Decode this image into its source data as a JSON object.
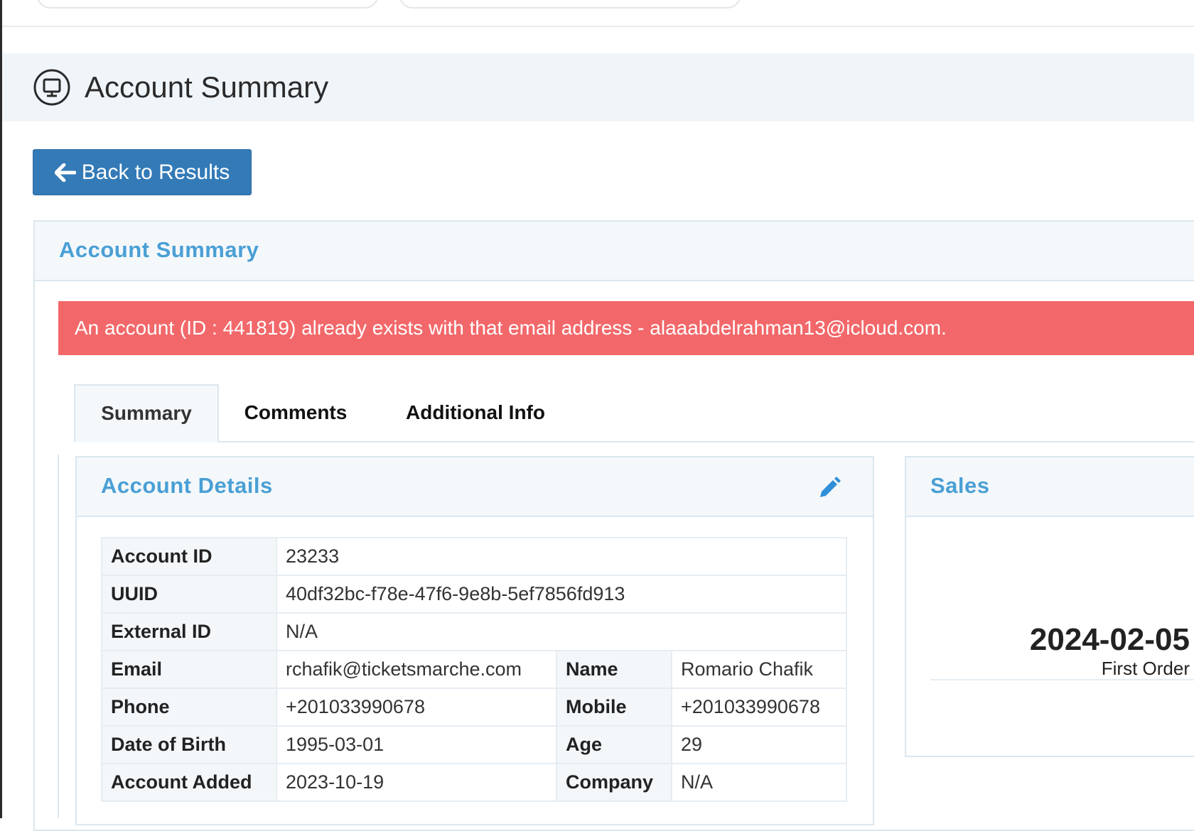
{
  "page": {
    "title": "Account Summary",
    "back_button": "Back to Results"
  },
  "panel": {
    "title": "Account Summary"
  },
  "alert": {
    "message": "An account (ID : 441819) already exists with that email address - alaaabdelrahman13@icloud.com."
  },
  "tabs": [
    {
      "label": "Summary",
      "active": true
    },
    {
      "label": "Comments",
      "active": false
    },
    {
      "label": "Additional Info",
      "active": false
    }
  ],
  "account_details": {
    "title": "Account Details",
    "rows": {
      "account_id": {
        "label": "Account ID",
        "value": "23233"
      },
      "uuid": {
        "label": "UUID",
        "value": "40df32bc-f78e-47f6-9e8b-5ef7856fd913"
      },
      "external_id": {
        "label": "External ID",
        "value": "N/A"
      },
      "email": {
        "label": "Email",
        "value": "rchafik@ticketsmarche.com"
      },
      "name": {
        "label": "Name",
        "value": "Romario Chafik"
      },
      "phone": {
        "label": "Phone",
        "value": "+201033990678"
      },
      "mobile": {
        "label": "Mobile",
        "value": "+201033990678"
      },
      "dob": {
        "label": "Date of Birth",
        "value": "1995-03-01"
      },
      "age": {
        "label": "Age",
        "value": "29"
      },
      "account_added": {
        "label": "Account Added",
        "value": "2023-10-19"
      },
      "company": {
        "label": "Company",
        "value": "N/A"
      }
    }
  },
  "sales": {
    "title": "Sales",
    "first_order_date": "2024-02-05",
    "first_order_label": "First Order"
  },
  "colors": {
    "primary": "#337ab7",
    "heading_blue": "#4a9fd5",
    "alert_red": "#f2686a",
    "panel_bg": "#f4f8fb"
  }
}
